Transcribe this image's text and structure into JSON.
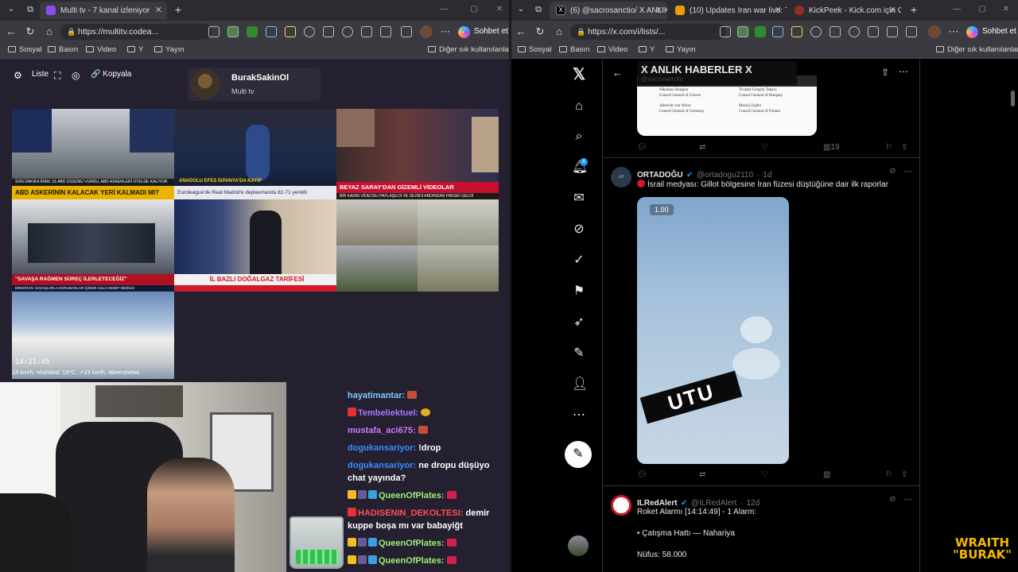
{
  "left_browser": {
    "tabs": [
      {
        "title": "Multi tv - 7 kanal izleniyor",
        "active": true
      }
    ],
    "url": "https://multitv.codea...",
    "copilot_label": "Sohbet et",
    "bookmarks": [
      "Sosyal",
      "Basın",
      "Video",
      "Y",
      "Yayın"
    ],
    "other_bookmarks": "Diğer sık kullanılanlar"
  },
  "right_browser": {
    "tabs": [
      {
        "title": "(6) @sacrosanctio/ X ANLIK",
        "active": true
      },
      {
        "title": "(10) Updates Iran war live: Trum",
        "active": false
      },
      {
        "title": "KickPeek - Kick.com için Gerçek",
        "active": false
      }
    ],
    "url": "https://x.com/i/lists/...",
    "copilot_label": "Sohbet et",
    "bookmarks": [
      "Sosyal",
      "Basın",
      "Video",
      "Y",
      "Yayın"
    ],
    "other_bookmarks": "Diğer sık kullanılanlar"
  },
  "multitv": {
    "controls": {
      "list": "Liste",
      "copy": "Kopyala"
    },
    "profile": {
      "name": "BurakSakinOl",
      "subtitle": "Multi tv"
    },
    "tiles": [
      {
        "ticker": "ABD ASKERİNİN KALACAK YERİ KALMADI MI?",
        "ticker_color": "#e8b400",
        "sub": "SON DAKİKA İRAN: 15 ABD ÜSSÜNÜ VURDU, ABD ASKERLERİ OTELDE KALIYOR"
      },
      {
        "ticker": "Euroleague'de Real Madrid'e deplasmanda 82-71 yenildi",
        "ticker_color": "#1d4fa6",
        "sub": "ANADOLU EFES İSPANYA'DA KAYIP"
      },
      {
        "ticker": "BEYAZ SARAY'DAN GİZEMLİ VİDEOLAR",
        "ticker_color": "#c8102e",
        "sub": "BİR KADIN VİDEOSU PAYLAŞILDI VE SİLİNDİ ARDINDAN FRESKİ GELDİ"
      },
      {
        "ticker": "\"SAVAŞA RAĞMEN SÜREÇ İLERLETECEĞİZ\"",
        "ticker_color": "#b01020",
        "sub": "ERDOĞAN: SAVAŞLARLA KORUNANLAR İÇİNDE ASLA HEDEF DEĞİLİZ"
      },
      {
        "ticker": "İL BAZLI DOĞALGAZ TARİFESİ",
        "ticker_color": "#d01a2a",
        "sub": ""
      },
      {
        "ticker": "",
        "ticker_color": "",
        "sub": ""
      },
      {
        "ticker": "",
        "ticker_color": "",
        "sub": "",
        "clock": "14:21:45",
        "weather": "24 km/h, •Ashdod: 19°C, ↗23 km/h, •Beersheba"
      }
    ]
  },
  "chat": [
    {
      "user": "hayatimantar:",
      "color": "#7ecbff",
      "msg": ""
    },
    {
      "user": "Tembeliektuel:",
      "color": "#a17bff",
      "msg": ""
    },
    {
      "user": "mustafa_aci675:",
      "color": "#c97bff",
      "msg": ""
    },
    {
      "user": "dogukansariyor:",
      "color": "#3c8cff",
      "msg": "!drop"
    },
    {
      "user": "dogukansariyor:",
      "color": "#3c8cff",
      "msg": "ne dropu düşüyo chat yayında?"
    },
    {
      "user": "QueenOfPlates:",
      "color": "#9cf07a",
      "msg": ""
    },
    {
      "user": "HADISENIN_DEKOLTESI:",
      "color": "#ff4f5c",
      "msg": "demir kuppe boşa mı var babayiğt"
    },
    {
      "user": "QueenOfPlates:",
      "color": "#9cf07a",
      "msg": ""
    },
    {
      "user": "QueenOfPlates:",
      "color": "#9cf07a",
      "msg": ""
    }
  ],
  "x": {
    "list_title": "X ANLIK HABERLER X",
    "list_handle": "@sacrosanctio",
    "doc_lines": [
      [
        "Nikolaos Stergiou",
        "Tivadar Gergely Takacs"
      ],
      [
        "Consul General of Greece",
        "Consul General of Hungary"
      ],
      [
        "Albrecht von Wiese",
        "Maciej Zajdel"
      ],
      [
        "Consul General of Germany",
        "Consul General of Poland"
      ]
    ],
    "post1_views": "19",
    "post2": {
      "name": "ORTADOĞU",
      "handle": "@ortadogu2110",
      "time": "1d",
      "text": "İsrail medyası: Gillot bölgesine İran füzesi düştüğüne dair ilk raporlar",
      "video_speed": "1.00",
      "video_label": "UTU"
    },
    "post3": {
      "name": "ILRedAlert",
      "handle": "@ILRedAlert",
      "time": "12d",
      "line1": "Roket Alarmı [14:14:49] - 1 Alarm:",
      "line2": "• Çatışma Hattı — Nahariya",
      "line3": "Nüfus: 58.000"
    }
  },
  "watermark": {
    "line1": "WRAITH",
    "line2": "\"BURAK\""
  },
  "colors": {
    "accent_x": "#1d9bf0",
    "tab_bg": "#2b2b30",
    "toolbar_bg": "#3a3a40"
  }
}
